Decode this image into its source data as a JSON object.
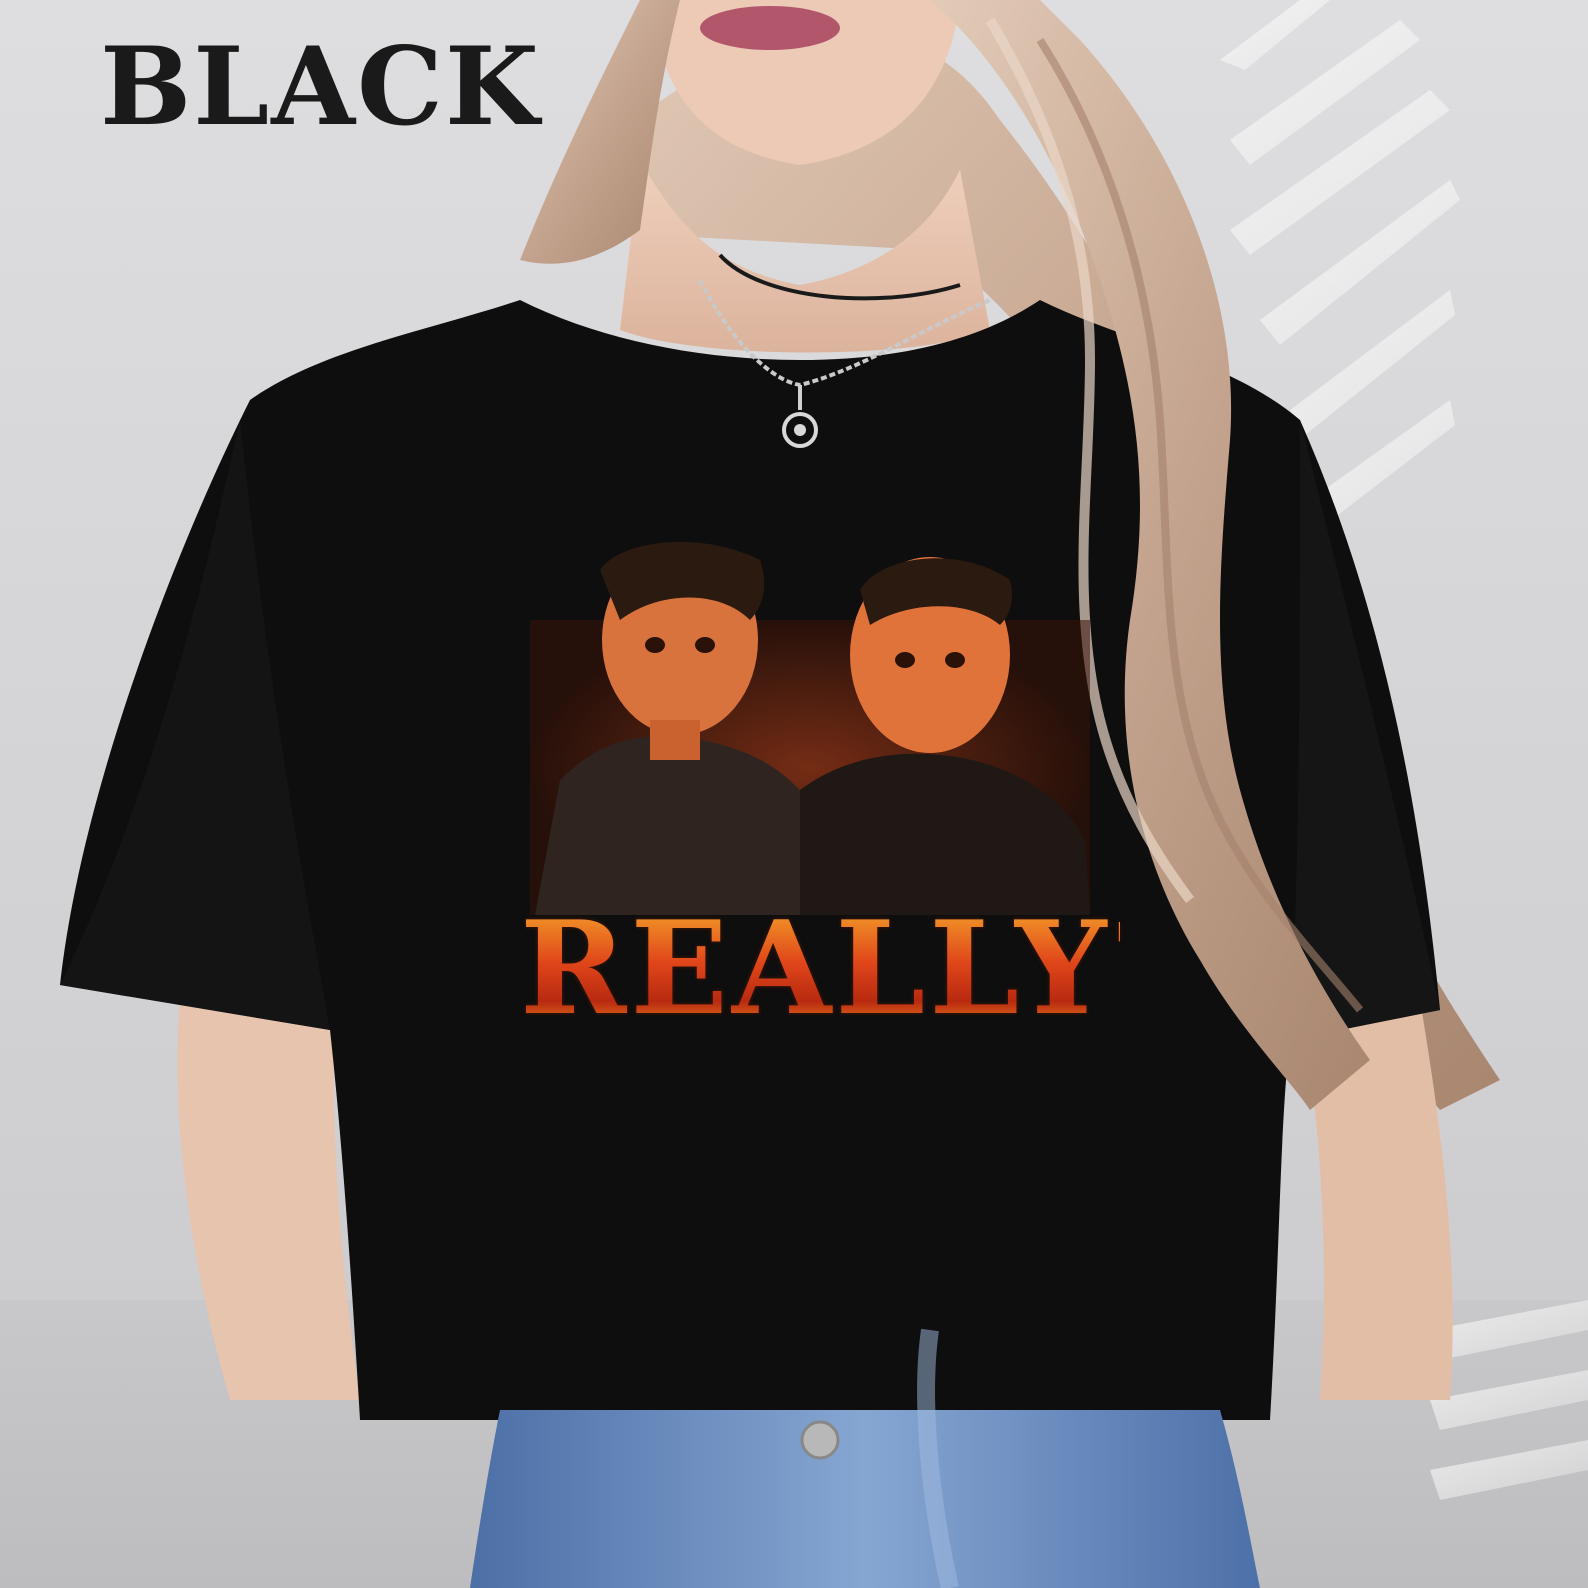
{
  "product": {
    "color_label": "BLACK",
    "print_text": "REALLY?"
  },
  "colors": {
    "shirt": "#0e0e0e",
    "hair": "#c9ab95",
    "jeans": "#5f84ba",
    "print_fire": "#e2561a",
    "background_wall": "#d8d8da"
  },
  "icons": {
    "necklace_pendant": "pendant-icon"
  }
}
